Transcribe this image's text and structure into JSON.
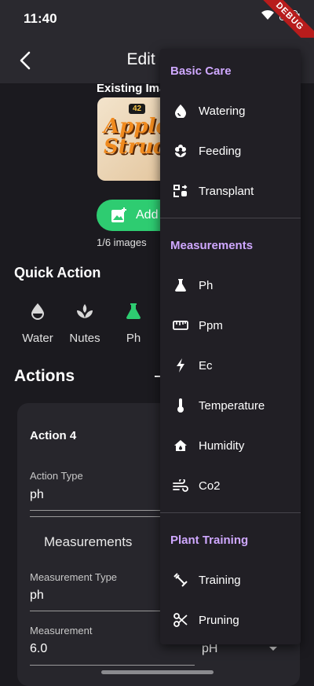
{
  "status": {
    "time": "11:40",
    "debug_label": "DEBUG"
  },
  "app_bar": {
    "title": "Edit Log"
  },
  "images": {
    "existing_label": "Existing Images",
    "thumb_badge": "42",
    "thumb_text": "Apple Strudel",
    "add_label": "Add",
    "count": "1/6 images"
  },
  "quick_action": {
    "title": "Quick Action",
    "items": [
      {
        "label": "Water",
        "icon": "water-drop-icon",
        "color": "#d8d8d8"
      },
      {
        "label": "Nutes",
        "icon": "nutes-icon",
        "color": "#d8d8d8"
      },
      {
        "label": "Ph",
        "icon": "flask-icon",
        "color": "#2ecc71"
      }
    ]
  },
  "actions": {
    "title": "Actions",
    "card": {
      "name": "Action 4",
      "action_type_label": "Action Type",
      "action_type_value": "ph",
      "measurements_header": "Measurements",
      "measurement_type_label": "Measurement Type",
      "measurement_type_value": "ph",
      "measurement_label": "Measurement",
      "measurement_value": "6.0",
      "unit_value": "pH"
    }
  },
  "menu": {
    "sections": [
      {
        "header": "Basic Care",
        "items": [
          {
            "label": "Watering",
            "icon": "water-drop-icon"
          },
          {
            "label": "Feeding",
            "icon": "flower-icon"
          },
          {
            "label": "Transplant",
            "icon": "transplant-icon"
          }
        ]
      },
      {
        "header": "Measurements",
        "items": [
          {
            "label": "Ph",
            "icon": "flask-icon"
          },
          {
            "label": "Ppm",
            "icon": "ruler-icon"
          },
          {
            "label": "Ec",
            "icon": "bolt-icon"
          },
          {
            "label": "Temperature",
            "icon": "thermometer-icon"
          },
          {
            "label": "Humidity",
            "icon": "home-icon"
          },
          {
            "label": "Co2",
            "icon": "wind-icon"
          }
        ]
      },
      {
        "header": "Plant Training",
        "items": [
          {
            "label": "Training",
            "icon": "training-icon"
          },
          {
            "label": "Pruning",
            "icon": "scissors-icon"
          }
        ]
      }
    ]
  },
  "colors": {
    "accent_green": "#2ecc71",
    "menu_header": "#cfa8ff",
    "background": "#1b1a1f"
  }
}
